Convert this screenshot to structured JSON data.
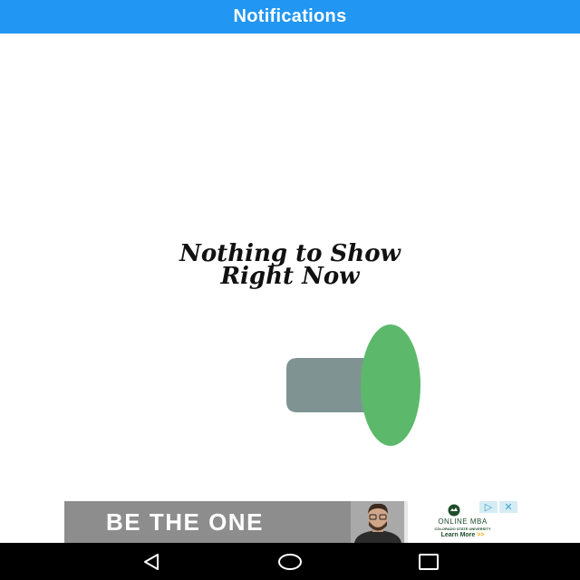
{
  "app_bar": {
    "title": "Notifications"
  },
  "empty_state": {
    "line1": "Nothing to Show",
    "line2": "Right Now",
    "illustration": "megaphone-icon"
  },
  "ad": {
    "headline": "BE THE ONE",
    "title": "ONLINE MBA",
    "subtitle": "COLORADO STATE UNIVERSITY",
    "cta": "Learn More",
    "cta_arrows": ">>",
    "choices_icons": [
      "adchoices-icon",
      "close-icon"
    ]
  },
  "nav_bar": {
    "icons": [
      "back-icon",
      "home-icon",
      "recents-icon"
    ]
  },
  "colors": {
    "primary": "#2196f3",
    "megaphone_green": "#5cb96b",
    "megaphone_gray": "#7f9393",
    "nav_bg": "#000000"
  }
}
